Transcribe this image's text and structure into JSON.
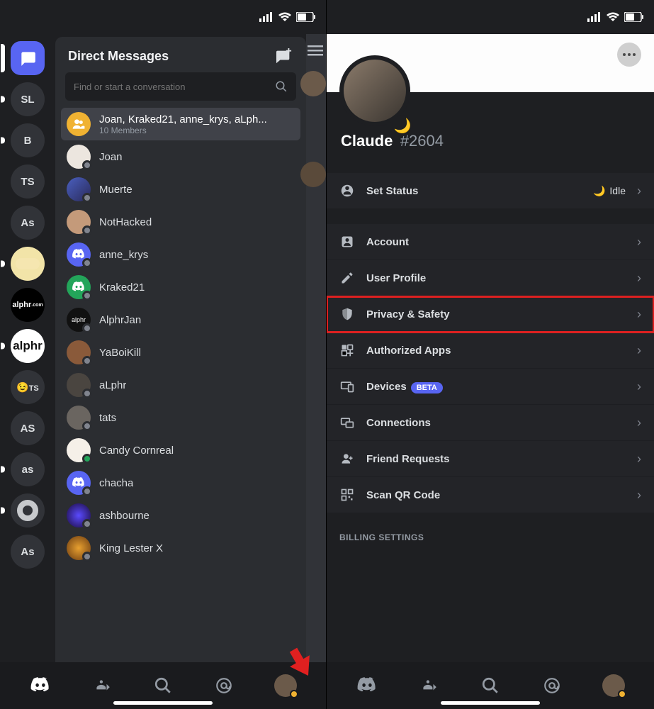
{
  "left": {
    "dm_header": "Direct Messages",
    "search_placeholder": "Find or start a conversation",
    "group": {
      "name": "Joan, Kraked21, anne_krys, aLph...",
      "sub": "10 Members"
    },
    "dms": [
      {
        "name": "Joan"
      },
      {
        "name": "Muerte"
      },
      {
        "name": "NotHacked"
      },
      {
        "name": "anne_krys"
      },
      {
        "name": "Kraked21"
      },
      {
        "name": "AlphrJan"
      },
      {
        "name": "YaBoiKill"
      },
      {
        "name": "aLphr"
      },
      {
        "name": "tats"
      },
      {
        "name": "Candy Cornreal"
      },
      {
        "name": "chacha"
      },
      {
        "name": "ashbourne"
      },
      {
        "name": "King Lester X"
      }
    ],
    "servers": [
      {
        "label": "",
        "type": "active"
      },
      {
        "label": "SL"
      },
      {
        "label": "B"
      },
      {
        "label": "TS"
      },
      {
        "label": "As"
      },
      {
        "type": "twinkie"
      },
      {
        "label": "alphr",
        "type": "alphr-dot"
      },
      {
        "label": "alphr",
        "type": "alphr-round"
      },
      {
        "label": "😉ᴛs",
        "type": "emoji"
      },
      {
        "label": "AS"
      },
      {
        "label": "as"
      },
      {
        "type": "ring"
      },
      {
        "label": "As"
      }
    ]
  },
  "right": {
    "username": "Claude",
    "tag": "#2604",
    "status": {
      "label": "Set Status",
      "value": "Idle"
    },
    "rows": [
      {
        "label": "Account",
        "icon": "account"
      },
      {
        "label": "User Profile",
        "icon": "pencil"
      },
      {
        "label": "Privacy & Safety",
        "icon": "shield",
        "hl": true
      },
      {
        "label": "Authorized Apps",
        "icon": "apps"
      },
      {
        "label": "Devices",
        "icon": "devices",
        "beta": "BETA"
      },
      {
        "label": "Connections",
        "icon": "connections"
      },
      {
        "label": "Friend Requests",
        "icon": "friend"
      },
      {
        "label": "Scan QR Code",
        "icon": "qr"
      }
    ],
    "section": "BILLING SETTINGS"
  }
}
